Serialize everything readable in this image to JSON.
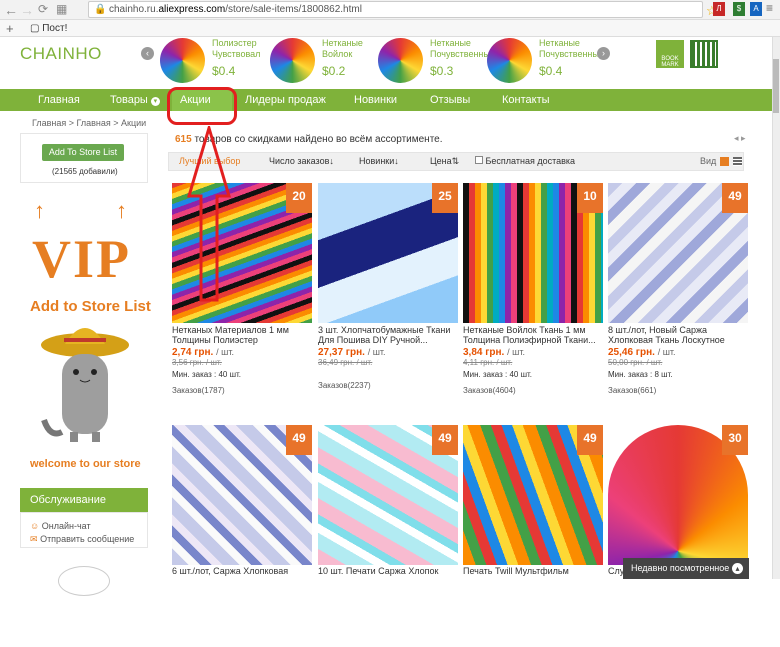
{
  "browser": {
    "url_host": "chainho.ru.",
    "url_domain": "aliexpress.com",
    "url_path": "/store/sale-items/1800862.html",
    "bookmark": "Пост!"
  },
  "store": {
    "logo": "CHAINHO"
  },
  "top_products": [
    {
      "title": "Полиэстер",
      "sub": "Чувствовал",
      "price": "$0.4"
    },
    {
      "title": "Нетканые",
      "sub": "Войлок",
      "price": "$0.2"
    },
    {
      "title": "Нетканые",
      "sub": "Почувственный",
      "price": "$0.3"
    },
    {
      "title": "Нетканые",
      "sub": "Почувственные",
      "price": "$0.4"
    }
  ],
  "bookmark_label": "BOOK MARK",
  "nav": [
    "Главная",
    "Товары",
    "Акции",
    "Лидеры продаж",
    "Новинки",
    "Отзывы",
    "Контакты"
  ],
  "breadcrumb": "Главная > Главная > Акции",
  "sidebar": {
    "add_btn": "Add To Store List",
    "added": "(21565 добавили)",
    "vip": "VIP",
    "add_list": "Add to Store List",
    "welcome": "welcome to our store",
    "service": "Обслуживание",
    "chat": "Онлайн-чат",
    "msg": "Отправить сообщение"
  },
  "results": {
    "count": "615",
    "text": "товаров со скидками найдено во всём ассортименте."
  },
  "sort": {
    "best": "Лучший выбор",
    "orders": "Число заказов",
    "new": "Новинки",
    "price": "Цена",
    "free": "Бесплатная доставка",
    "view": "Вид"
  },
  "products": [
    {
      "disc": "20",
      "title": "Нетканых Материалов 1 мм Толщины Полиэстер Чувствовал...",
      "price": "2,74 грн.",
      "unit": "/ шт.",
      "old": "3,56 грн. / шт.",
      "min": "Мин. заказ : 40 шт.",
      "orders": "Заказов(1787)"
    },
    {
      "disc": "25",
      "title": "3 шт. Хлопчатобумажные Ткани Для Пошива DIY Ручной...",
      "price": "27,37 грн.",
      "unit": "/ шт.",
      "old": "36,49 грн. / шт.",
      "min": "",
      "orders": "Заказов(2237)"
    },
    {
      "disc": "10",
      "title": "Нетканые Войлок Ткань 1 мм Толщина Полиэфирной Ткани...",
      "price": "3,84 грн.",
      "unit": "/ шт.",
      "old": "4,11 грн. / шт.",
      "min": "Мин. заказ : 40 шт.",
      "orders": "Заказов(4604)"
    },
    {
      "disc": "49",
      "title": "8 шт./лот, Новый Саржа Хлопковая Ткань Лоскутное Серый...",
      "price": "25,46 грн.",
      "unit": "/ шт.",
      "old": "50,00 грн. / шт.",
      "min": "Мин. заказ : 8 шт.",
      "orders": "Заказов(661)"
    },
    {
      "disc": "49",
      "title": "6 шт./лот, Саржа Хлопковая",
      "price": "",
      "unit": "",
      "old": "",
      "min": "",
      "orders": ""
    },
    {
      "disc": "49",
      "title": "10 шт. Печати Саржа Хлопок",
      "price": "",
      "unit": "",
      "old": "",
      "min": "",
      "orders": ""
    },
    {
      "disc": "49",
      "title": "Печать Twill Мультфильм",
      "price": "",
      "unit": "",
      "old": "",
      "min": "",
      "orders": ""
    },
    {
      "disc": "30",
      "title": "Слу",
      "price": "",
      "unit": "",
      "old": "",
      "min": "",
      "orders": ""
    }
  ],
  "recent": "Недавно посмотренное",
  "colors": {
    "accent": "#7fb23a",
    "orange": "#e67e22",
    "discount": "#e8732a",
    "annotation": "#e21f1f"
  }
}
